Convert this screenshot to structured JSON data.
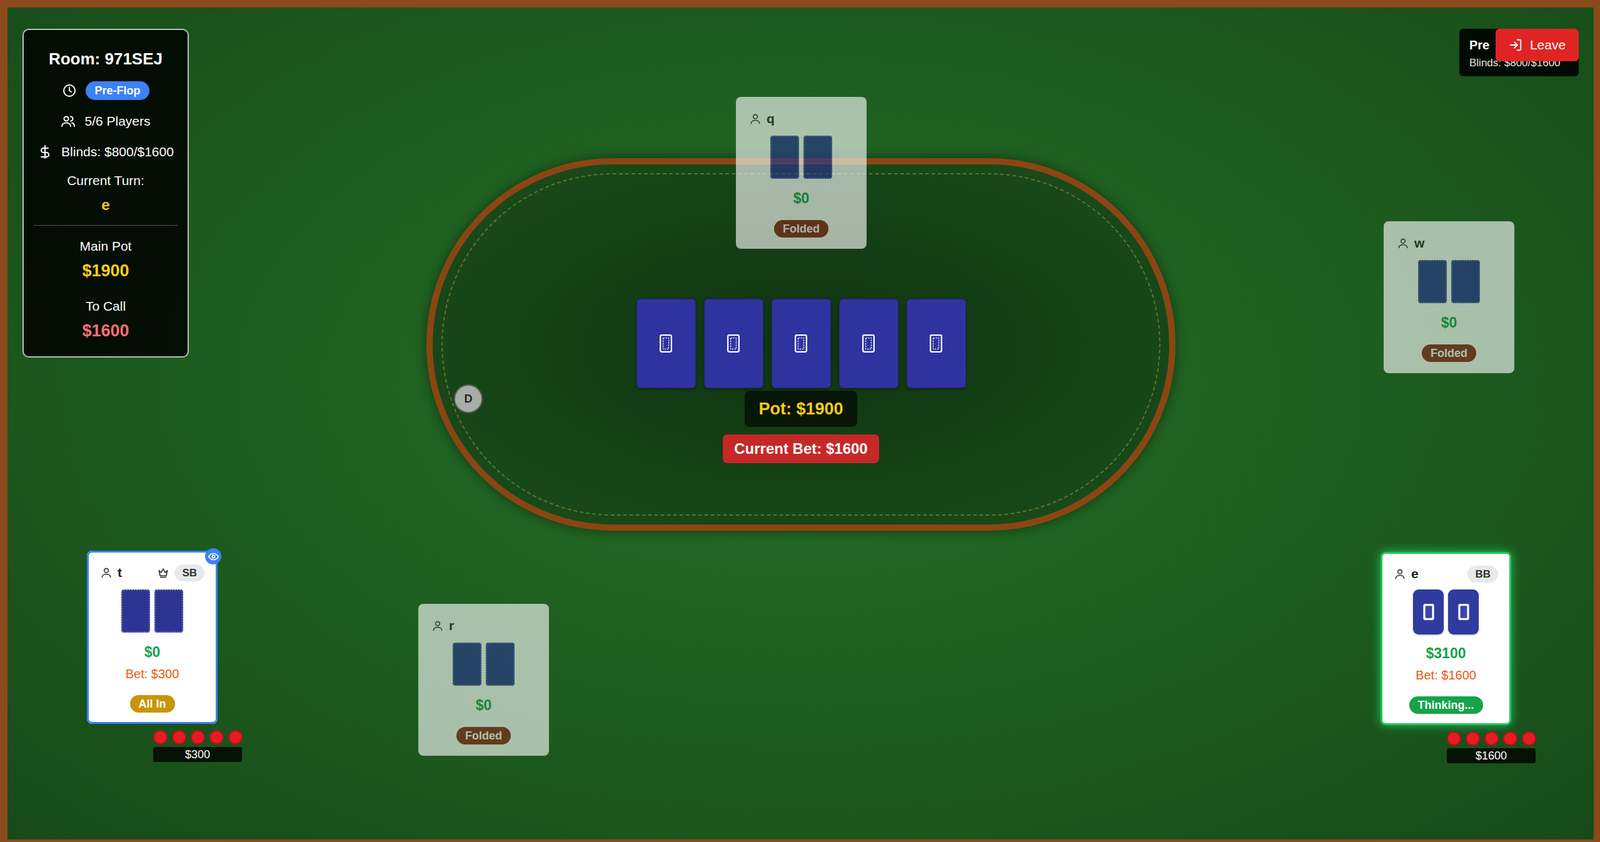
{
  "room_panel": {
    "title": "Room: 971SEJ",
    "phase": "Pre-Flop",
    "players": "5/6 Players",
    "blinds": "Blinds: $800/$1600",
    "turn_label": "Current Turn:",
    "turn": "e",
    "pot_label": "Main Pot",
    "pot": "$1900",
    "call_label": "To Call",
    "call": "$1600"
  },
  "corner": {
    "title": "Pre",
    "blinds": "Blinds: $800/$1600",
    "leave": "Leave"
  },
  "board": {
    "cards": [
      {
        "face_down": true,
        "kind": "icon"
      },
      {
        "face_down": true,
        "kind": "icon"
      },
      {
        "face_down": true,
        "kind": "icon"
      },
      {
        "face_down": true,
        "kind": "icon"
      },
      {
        "face_down": true,
        "kind": "icon"
      }
    ],
    "pot": "Pot: $1900",
    "current_bet": "Current Bet: $1600",
    "dealer": "D"
  },
  "seats": [
    {
      "name": "q",
      "host": false,
      "stack": "$0",
      "status": "Folded",
      "kind": "folded",
      "folded": true,
      "viewer": false,
      "acting": false,
      "cards": [
        {
          "face_down": true,
          "kind": "plain"
        },
        {
          "face_down": true,
          "kind": "plain"
        }
      ]
    },
    {
      "name": "w",
      "host": false,
      "stack": "$0",
      "status": "Folded",
      "kind": "folded",
      "folded": true,
      "viewer": false,
      "acting": false,
      "cards": [
        {
          "face_down": true,
          "kind": "plain"
        },
        {
          "face_down": true,
          "kind": "plain"
        }
      ]
    },
    {
      "name": "r",
      "host": false,
      "stack": "$0",
      "status": "Folded",
      "kind": "folded",
      "folded": true,
      "viewer": false,
      "acting": false,
      "cards": [
        {
          "face_down": true,
          "kind": "plain"
        },
        {
          "face_down": true,
          "kind": "plain"
        }
      ]
    },
    {
      "name": "t",
      "host": true,
      "role": "SB",
      "stack": "$0",
      "bet": "Bet: $300",
      "status": "All In",
      "kind": "all-in",
      "folded": false,
      "viewer": true,
      "acting": false,
      "cards": [
        {
          "face_down": true,
          "kind": "plain"
        },
        {
          "face_down": true,
          "kind": "plain"
        }
      ],
      "chips": {
        "count": 5,
        "amount": "$300"
      }
    },
    {
      "name": "e",
      "host": false,
      "role": "BB",
      "stack": "$3100",
      "bet": "Bet: $1600",
      "status": "Thinking...",
      "kind": "thinking",
      "folded": false,
      "viewer": false,
      "acting": true,
      "cards": [
        {
          "face_down": true,
          "kind": "icon"
        },
        {
          "face_down": true,
          "kind": "icon"
        }
      ],
      "chips": {
        "count": 5,
        "amount": "$1600"
      }
    }
  ]
}
